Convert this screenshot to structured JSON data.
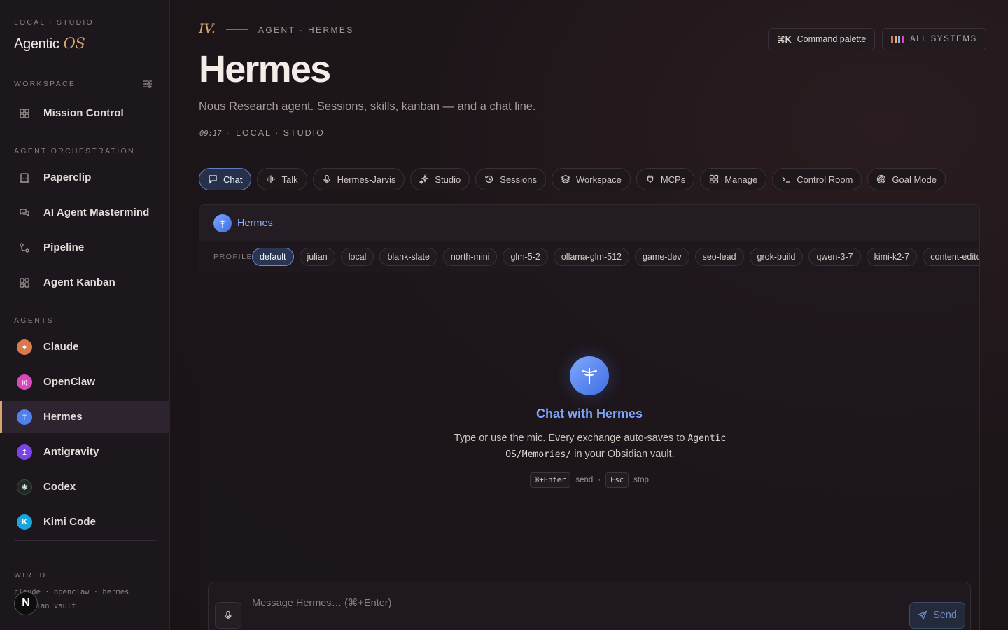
{
  "sidebar": {
    "kicker": "LOCAL · STUDIO",
    "brand": "Agentic",
    "brand_suffix": "OS",
    "workspace_label": "WORKSPACE",
    "workspace_items": [
      {
        "label": "Mission Control",
        "icon": "grid-icon"
      }
    ],
    "orchestration_label": "AGENT ORCHESTRATION",
    "orchestration_items": [
      {
        "label": "Paperclip",
        "icon": "building-icon"
      },
      {
        "label": "AI Agent Mastermind",
        "icon": "chat-bubbles-icon"
      },
      {
        "label": "Pipeline",
        "icon": "pipeline-icon"
      },
      {
        "label": "Agent Kanban",
        "icon": "kanban-icon"
      }
    ],
    "agents_label": "AGENTS",
    "agents": [
      {
        "label": "Claude",
        "glyph": "✦",
        "color": "#d97a4e"
      },
      {
        "label": "OpenClaw",
        "glyph": ")))",
        "color": "#d54bbd"
      },
      {
        "label": "Hermes",
        "glyph": "⚚",
        "color": "#4f80ee"
      },
      {
        "label": "Antigravity",
        "glyph": "↥",
        "color": "#7a45e6"
      },
      {
        "label": "Codex",
        "glyph": "❃",
        "color": "#1e2b26"
      },
      {
        "label": "Kimi Code",
        "glyph": "K",
        "color": "#1aa6d8"
      }
    ],
    "wired_label": "WIRED",
    "wired_line1": "claude · openclaw · hermes",
    "wired_line2": "obsidian vault",
    "n_badge": "N"
  },
  "header": {
    "roman": "IV.",
    "kicker": "AGENT · HERMES",
    "title": "Hermes",
    "subtitle": "Nous Research agent. Sessions, skills, kanban — and a chat line.",
    "time": "09:17",
    "meta_sep": "·",
    "location": "LOCAL · STUDIO",
    "command_key": "⌘K",
    "command_label": "Command palette",
    "systems_label": "ALL SYSTEMS"
  },
  "tabs": [
    {
      "label": "Chat",
      "icon": "chat-icon",
      "active": true
    },
    {
      "label": "Talk",
      "icon": "waveform-icon"
    },
    {
      "label": "Hermes-Jarvis",
      "icon": "mic-icon"
    },
    {
      "label": "Studio",
      "icon": "sparkle-icon"
    },
    {
      "label": "Sessions",
      "icon": "history-icon"
    },
    {
      "label": "Workspace",
      "icon": "layers-icon"
    },
    {
      "label": "MCPs",
      "icon": "plug-icon"
    },
    {
      "label": "Manage",
      "icon": "grid-icon"
    },
    {
      "label": "Control Room",
      "icon": "terminal-icon"
    },
    {
      "label": "Goal Mode",
      "icon": "target-icon"
    }
  ],
  "chat": {
    "agent_name": "Hermes",
    "profile_label": "PROFILE",
    "profiles": [
      "default",
      "julian",
      "local",
      "blank-slate",
      "north-mini",
      "glm-5-2",
      "ollama-glm-512",
      "game-dev",
      "seo-lead",
      "grok-build",
      "qwen-3-7",
      "kimi-k2-7",
      "content-editor"
    ],
    "active_profile": "default",
    "empty_title": "Chat with Hermes",
    "empty_desc_1": "Type or use the mic. Every exchange auto-saves to ",
    "empty_desc_code": "Agentic OS/Memories/",
    "empty_desc_2": " in your Obsidian vault.",
    "hint_send_key": "⌘+Enter",
    "hint_send": "send",
    "hint_sep": "·",
    "hint_stop_key": "Esc",
    "hint_stop": "stop",
    "input_placeholder": "Message Hermes… (⌘+Enter)",
    "send_label": "Send"
  },
  "colors": {
    "accent": "#d9a56f",
    "active_blue": "#5d7fc7",
    "system_bars": [
      "#d97a4e",
      "#e0b36a",
      "#8fb2ff",
      "#d54bbd"
    ]
  }
}
